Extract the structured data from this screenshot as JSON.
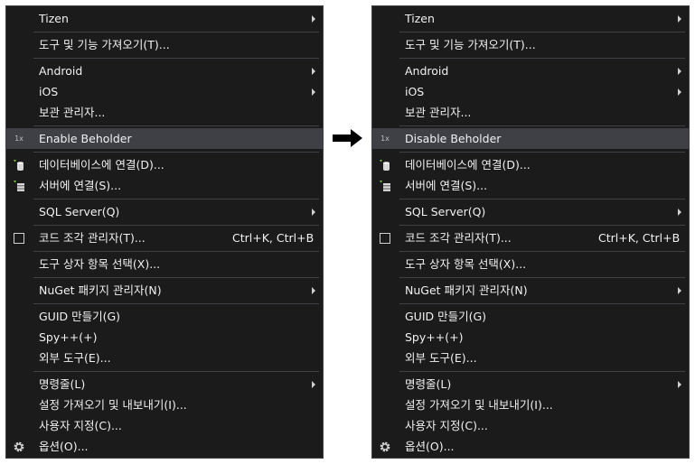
{
  "left_menu": {
    "tizen": "Tizen",
    "import_tools": "도구 및 기능 가져오기(T)...",
    "android": "Android",
    "ios": "iOS",
    "archive_manager": "보관 관리자...",
    "beholder_icon_text": "1x",
    "beholder": "Enable Beholder",
    "connect_db": "데이터베이스에 연결(D)...",
    "connect_server": "서버에 연결(S)...",
    "sql_server": "SQL Server(Q)",
    "snippet_manager": "코드 조각 관리자(T)...",
    "snippet_shortcut": "Ctrl+K, Ctrl+B",
    "toolbox_items": "도구 상자 항목 선택(X)...",
    "nuget": "NuGet 패키지 관리자(N)",
    "guid": "GUID 만들기(G)",
    "spy": "Spy++(+)",
    "external_tools": "외부 도구(E)...",
    "command_line": "명령줄(L)",
    "import_export": "설정 가져오기 및 내보내기(I)...",
    "customize": "사용자 지정(C)...",
    "options": "옵션(O)..."
  },
  "right_menu": {
    "tizen": "Tizen",
    "import_tools": "도구 및 기능 가져오기(T)...",
    "android": "Android",
    "ios": "iOS",
    "archive_manager": "보관 관리자...",
    "beholder_icon_text": "1x",
    "beholder": "Disable Beholder",
    "connect_db": "데이터베이스에 연결(D)...",
    "connect_server": "서버에 연결(S)...",
    "sql_server": "SQL Server(Q)",
    "snippet_manager": "코드 조각 관리자(T)...",
    "snippet_shortcut": "Ctrl+K, Ctrl+B",
    "toolbox_items": "도구 상자 항목 선택(X)...",
    "nuget": "NuGet 패키지 관리자(N)",
    "guid": "GUID 만들기(G)",
    "spy": "Spy++(+)",
    "external_tools": "외부 도구(E)...",
    "command_line": "명령줄(L)",
    "import_export": "설정 가져오기 및 내보내기(I)...",
    "customize": "사용자 지정(C)...",
    "options": "옵션(O)..."
  },
  "icons": {
    "beholder": "1x-badge-icon",
    "connect_db": "database-connect-icon",
    "connect_server": "server-connect-icon",
    "snippet_manager": "snippet-square-icon",
    "options": "gear-icon",
    "transition": "arrow-right-icon"
  },
  "colors": {
    "menu_bg": "#1b1b1c",
    "highlight_bg": "#3f3f46",
    "text": "#f1f1f1",
    "icon_green": "#7ac143"
  }
}
